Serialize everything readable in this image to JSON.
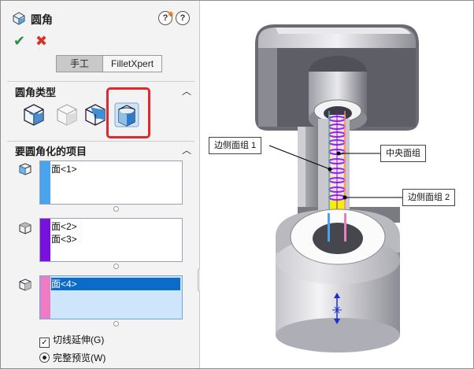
{
  "panel": {
    "title": "圆角",
    "help_icon_1": "help-star-icon",
    "help_icon_2": "help-icon",
    "ok_icon": "check-icon",
    "cancel_icon": "close-icon",
    "mode_tabs": [
      {
        "label": "手工",
        "active": true
      },
      {
        "label": "FilletXpert",
        "active": false
      }
    ],
    "section_fillet_type": {
      "title": "圆角类型",
      "types": [
        "constant-radius-fillet-icon",
        "variable-radius-fillet-icon",
        "face-fillet-icon",
        "full-round-fillet-icon"
      ],
      "selected_index": 3
    },
    "section_items": {
      "title": "要圆角化的项目",
      "side_face_set_1": {
        "items": [
          "面<1>"
        ],
        "strip_color": "#4aa3ef"
      },
      "center_face_set": {
        "items": [
          "面<2>",
          "面<3>"
        ],
        "strip_color": "#7a10e0"
      },
      "side_face_set_2": {
        "items": [
          "面<4>"
        ],
        "strip_color": "#ef7bc0",
        "selected_index": 0
      }
    },
    "tangent_propagation": {
      "label": "切线延伸(G)",
      "checked": true
    },
    "full_preview": {
      "label": "完整预览(W)",
      "selected": true
    }
  },
  "viewport": {
    "callouts": {
      "side_face_set_1": "边侧面组 1",
      "center_face_set": "中央面组",
      "side_face_set_2": "边侧面组 2"
    }
  },
  "colors": {
    "highlight": "#e0282e",
    "selection": "#0b6bc8",
    "face_yellow": "#f5f000",
    "face_purple": "#a020f0"
  }
}
